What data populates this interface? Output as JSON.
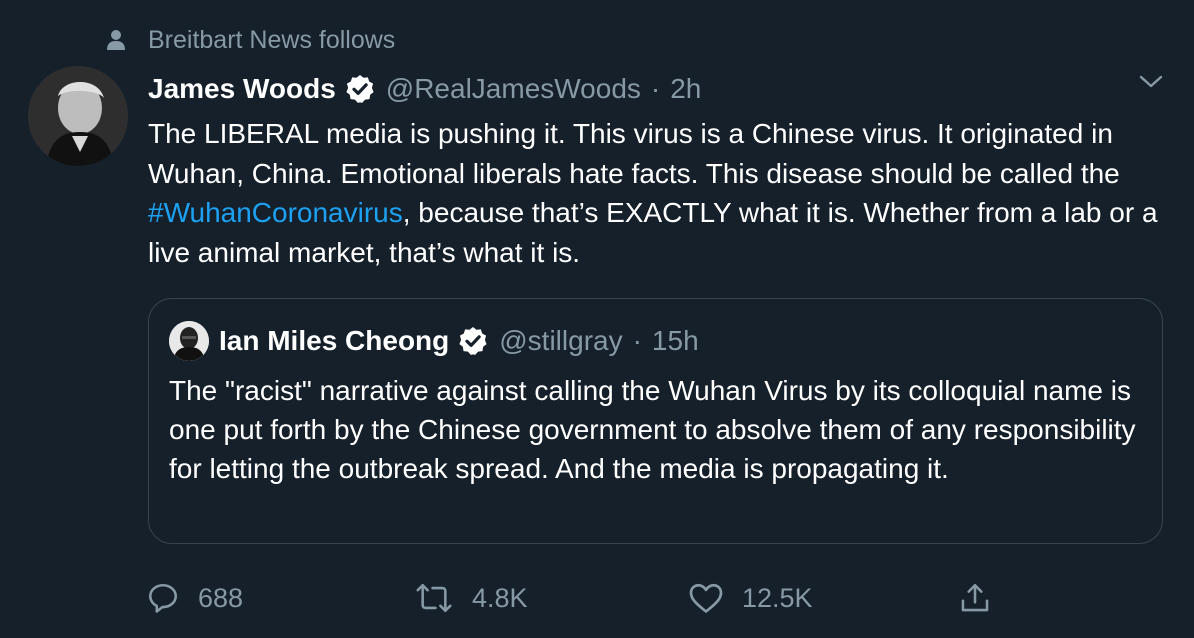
{
  "social_context": {
    "text": "Breitbart News follows",
    "icon": "person-icon"
  },
  "tweet": {
    "author_name": "James Woods",
    "verified": true,
    "handle": "@RealJamesWoods",
    "separator": "·",
    "time": "2h",
    "text_before": "The LIBERAL media is pushing it. This virus is a Chinese virus. It originated in Wuhan, China. Emotional liberals hate facts. This disease should be called the ",
    "hashtag": "#WuhanCoronavirus",
    "text_after": ", because that’s EXACTLY what it is. Whether from a lab or a live animal market, that’s what it is."
  },
  "quote": {
    "author_name": "Ian Miles Cheong",
    "verified": true,
    "handle": "@stillgray",
    "separator": "·",
    "time": "15h",
    "text": "The \"racist\" narrative against calling the Wuhan Virus by its colloquial name is one put forth by the Chinese government to absolve them of any responsibility for letting the outbreak spread. And the media is propagating it."
  },
  "actions": {
    "reply": {
      "icon": "reply-icon",
      "count": "688"
    },
    "retweet": {
      "icon": "retweet-icon",
      "count": "4.8K"
    },
    "like": {
      "icon": "heart-icon",
      "count": "12.5K"
    },
    "share": {
      "icon": "share-icon"
    }
  },
  "colors": {
    "background": "#15202b",
    "text": "#ffffff",
    "secondary": "#8899a6",
    "accent": "#1da1f2",
    "border": "#38444d"
  }
}
